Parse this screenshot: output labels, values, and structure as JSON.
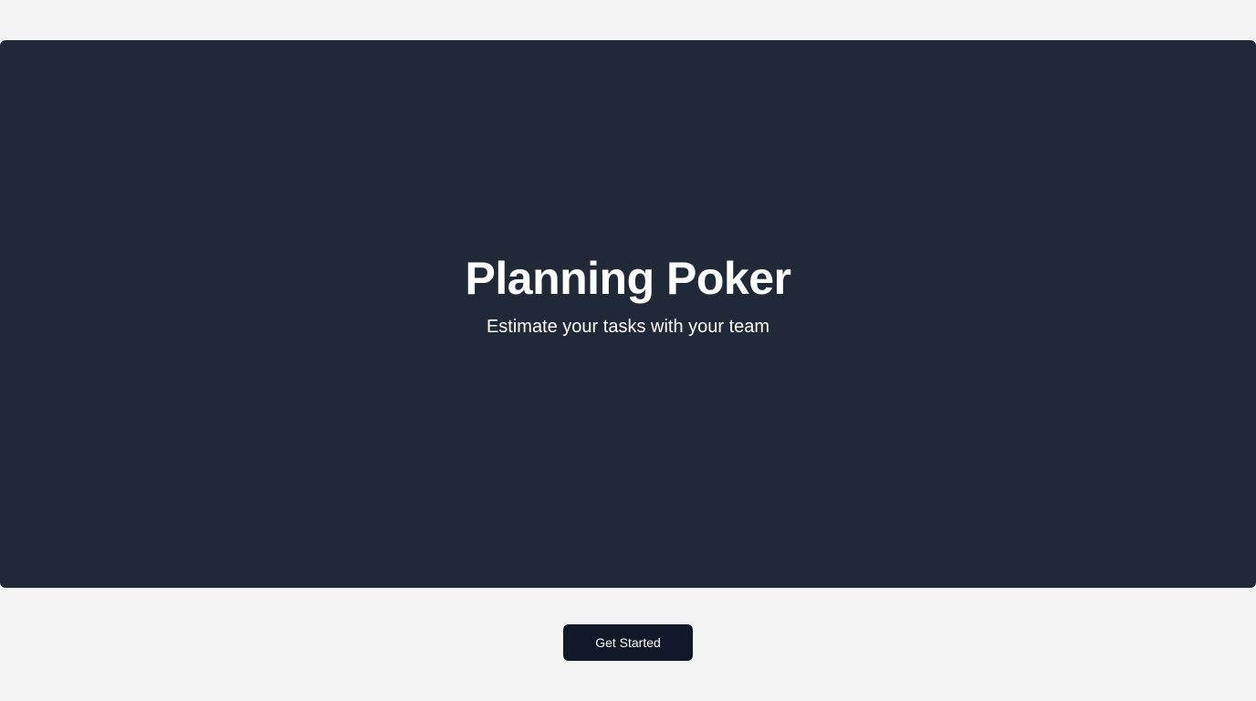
{
  "hero": {
    "title": "Planning Poker",
    "subtitle": "Estimate your tasks with your team"
  },
  "cta": {
    "label": "Get Started"
  },
  "colors": {
    "page_background": "#f4f4f5",
    "hero_background": "#202938",
    "button_background": "#111827",
    "text_light": "#ffffff"
  }
}
